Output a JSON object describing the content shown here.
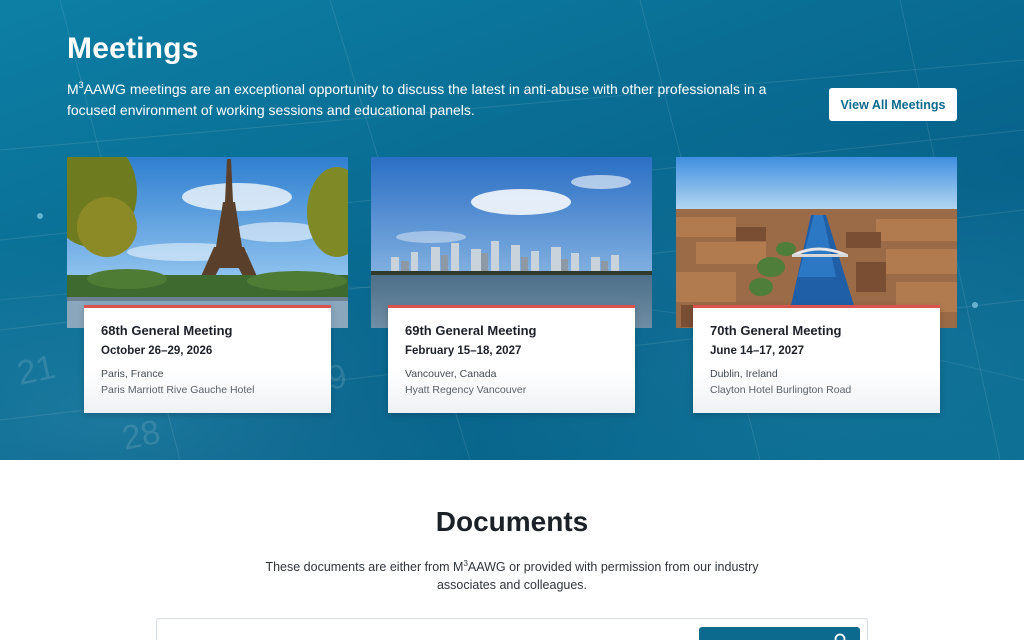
{
  "meetings": {
    "title": "Meetings",
    "description_pre": "M",
    "description_sup": "3",
    "description_post": "AAWG meetings are an exceptional opportunity to discuss the latest in anti-abuse with other professionals in a focused environment of working sessions and educational panels.",
    "view_all_label": "View All Meetings",
    "accent_color": "#d9534f",
    "cards": [
      {
        "name": "68th General Meeting",
        "dates": "October 26–29, 2026",
        "city": "Paris, France",
        "venue": "Paris Marriott Rive Gauche Hotel",
        "photo": "eiffel-tower-photo"
      },
      {
        "name": "69th General Meeting",
        "dates": "February 15–18, 2027",
        "city": "Vancouver, Canada",
        "venue": "Hyatt Regency Vancouver",
        "photo": "vancouver-skyline-photo"
      },
      {
        "name": "70th General Meeting",
        "dates": "June 14–17, 2027",
        "city": "Dublin, Ireland",
        "venue": "Clayton Hotel Burlington Road",
        "photo": "dublin-river-photo"
      }
    ]
  },
  "documents": {
    "title": "Documents",
    "description_pre": "These documents are either from M",
    "description_sup": "3",
    "description_post": "AAWG or provided with permission from our industry associates and colleagues.",
    "search_placeholder": "",
    "search_icon": "search-icon"
  }
}
